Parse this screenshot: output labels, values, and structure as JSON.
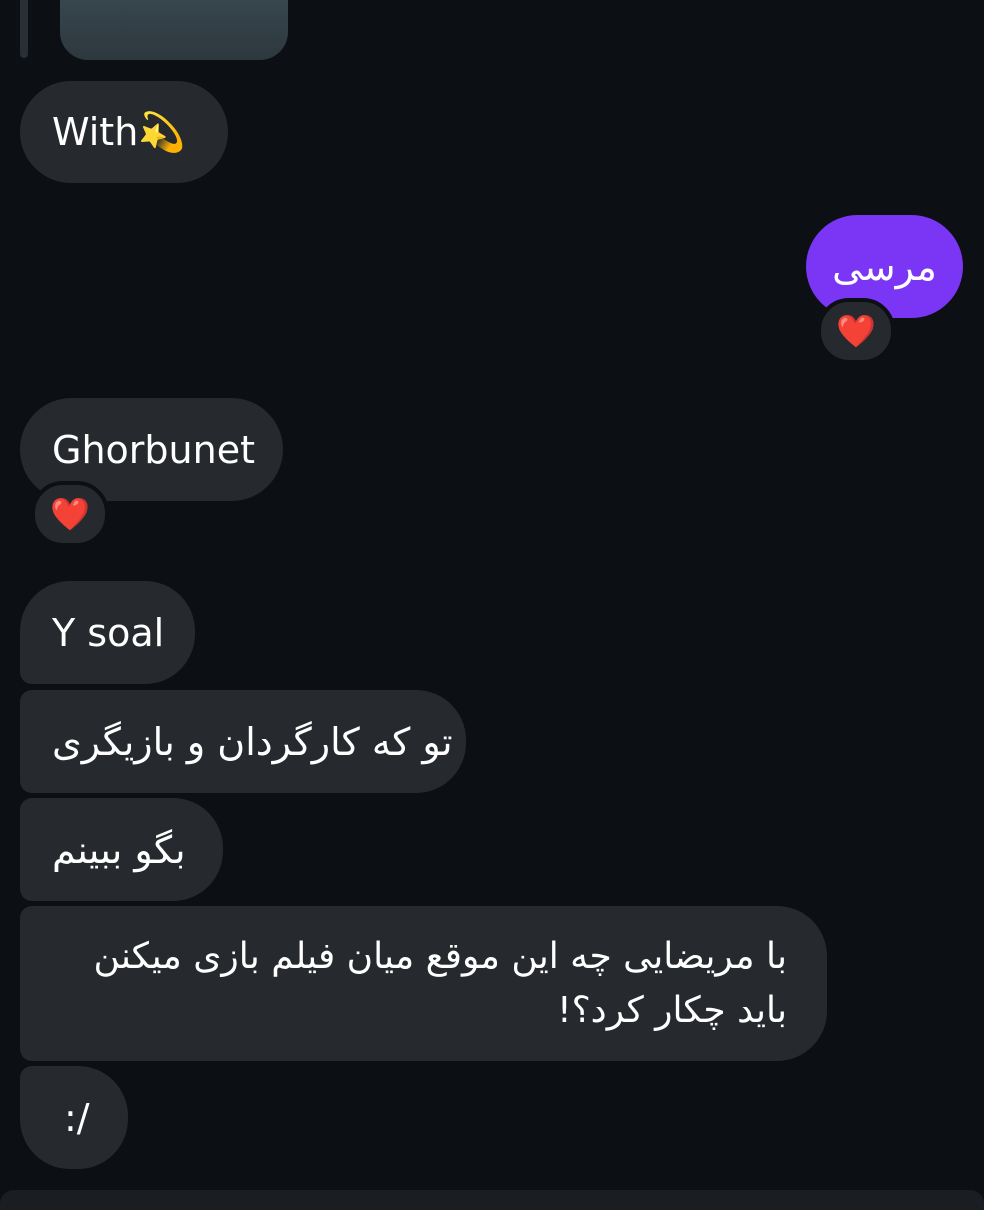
{
  "conversation": {
    "messages": [
      {
        "id": "m1",
        "sender": "them",
        "text": "With💫"
      },
      {
        "id": "m2",
        "sender": "me",
        "text": "مرسی",
        "reaction": "❤️"
      },
      {
        "id": "m3",
        "sender": "them",
        "text": "Ghorbunet",
        "reaction": "❤️"
      },
      {
        "id": "m4",
        "sender": "them",
        "text": "Y soal"
      },
      {
        "id": "m5",
        "sender": "them",
        "text": "تو که کارگردان و بازیگری"
      },
      {
        "id": "m6",
        "sender": "them",
        "text": "بگو ببینم"
      },
      {
        "id": "m7",
        "sender": "them",
        "lines": [
          "با مریضایی چه این موقع میان فیلم بازی میکنن",
          "باید چکار کرد؟!"
        ]
      },
      {
        "id": "m8",
        "sender": "them",
        "text": ":/"
      }
    ]
  },
  "colors": {
    "background": "#0c1014",
    "incoming_bubble": "#262a2f",
    "outgoing_bubble": "#7b36f5",
    "reaction_heart": "#ff2d3f"
  },
  "icons": {
    "reaction": "red-heart-icon",
    "emoji_in_text": "dizzy-star-emoji"
  }
}
